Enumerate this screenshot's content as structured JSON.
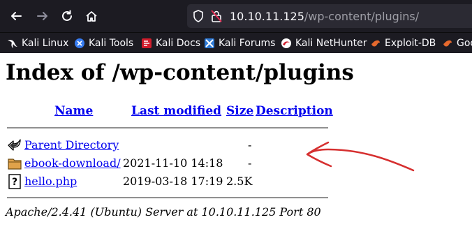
{
  "browser": {
    "url_host": "10.10.11.125",
    "url_path": "/wp-content/plugins/",
    "bookmarks": [
      {
        "label": "Kali Linux",
        "icon": "kali-dragon-icon"
      },
      {
        "label": "Kali Tools",
        "icon": "kali-tools-icon"
      },
      {
        "label": "Kali Docs",
        "icon": "kali-docs-icon"
      },
      {
        "label": "Kali Forums",
        "icon": "kali-forums-icon"
      },
      {
        "label": "Kali NetHunter",
        "icon": "kali-nethunter-icon"
      },
      {
        "label": "Exploit-DB",
        "icon": "exploit-db-icon"
      },
      {
        "label": "Goo",
        "icon": "google-hacking-db-icon"
      }
    ]
  },
  "page": {
    "title": "Index of /wp-content/plugins",
    "columns": {
      "name": "Name",
      "last_modified": "Last modified",
      "size": "Size",
      "description": "Description"
    },
    "rows": [
      {
        "name": "Parent Directory",
        "modified": "",
        "size": "-",
        "icon": "back-arrow-icon"
      },
      {
        "name": "ebook-download/",
        "modified": "2021-11-10 14:18",
        "size": "-",
        "icon": "folder-icon"
      },
      {
        "name": "hello.php",
        "modified": "2019-03-18 17:19",
        "size": "2.5K",
        "icon": "unknown-file-icon"
      }
    ],
    "footer": "Apache/2.4.41 (Ubuntu) Server at 10.10.11.125 Port 80"
  },
  "colors": {
    "toolbar_bg": "#1c1b22",
    "link": "#0000ee",
    "annotation": "#d62f2f"
  }
}
